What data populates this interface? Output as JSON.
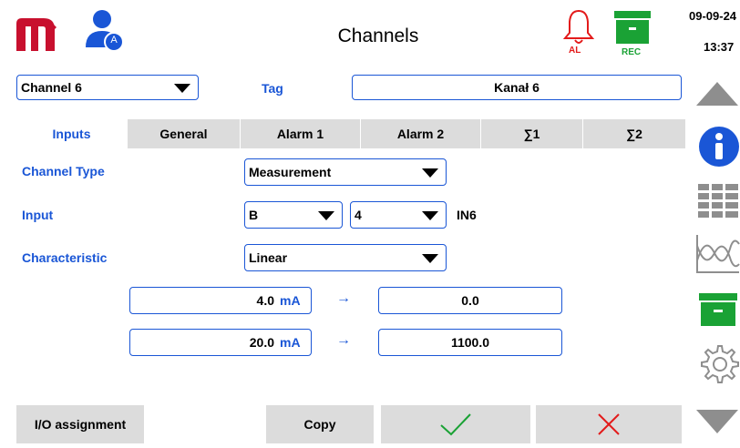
{
  "header": {
    "title": "Channels",
    "date": "09-09-24",
    "time": "13:37",
    "alarm_label": "AL",
    "rec_label": "REC",
    "user_badge": "A"
  },
  "channel_select": {
    "value": "Channel 6"
  },
  "tag": {
    "label": "Tag",
    "value": "Kanał 6"
  },
  "tabs": [
    {
      "label": "Inputs",
      "active": true
    },
    {
      "label": "General"
    },
    {
      "label": "Alarm 1"
    },
    {
      "label": "Alarm 2"
    },
    {
      "label": "∑1"
    },
    {
      "label": "∑2"
    }
  ],
  "form": {
    "channel_type": {
      "label": "Channel Type",
      "value": "Measurement"
    },
    "input": {
      "label": "Input",
      "slot": "B",
      "number": "4",
      "name": "IN6"
    },
    "characteristic": {
      "label": "Characteristic",
      "value": "Linear"
    },
    "scaling": [
      {
        "in_value": "4.0",
        "unit": "mA",
        "arrow": "→",
        "out_value": "0.0"
      },
      {
        "in_value": "20.0",
        "unit": "mA",
        "arrow": "→",
        "out_value": "1100.0"
      }
    ]
  },
  "footer": {
    "io_button": "I/O assignment",
    "copy_button": "Copy"
  },
  "colors": {
    "accent": "#1a56d6",
    "logo": "#c8102e",
    "alarm": "#e31b1b",
    "rec": "#1aa235",
    "nav_icon": "#8e8e8e"
  }
}
